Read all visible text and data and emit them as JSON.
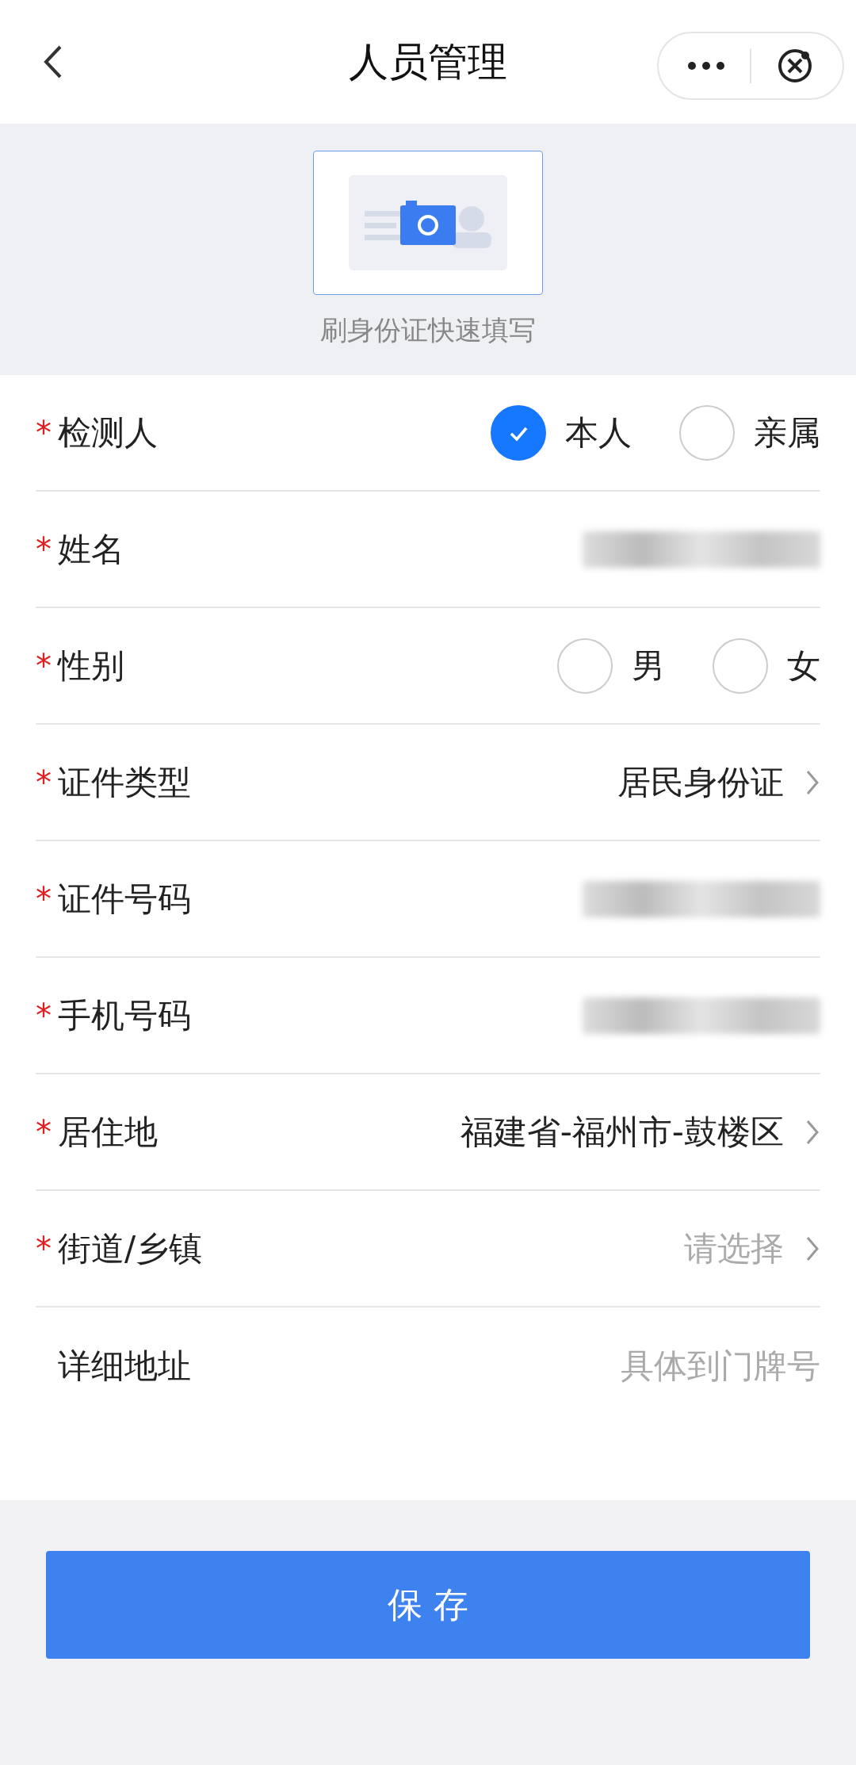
{
  "header": {
    "title": "人员管理"
  },
  "scan": {
    "caption": "刷身份证快速填写"
  },
  "rows": [
    {
      "kind": "radio",
      "mark": "*",
      "label": "检测人",
      "options": [
        {
          "label": "本人",
          "selected": true
        },
        {
          "label": "亲属",
          "selected": false
        }
      ]
    },
    {
      "kind": "redacted",
      "mark": "*",
      "label": "姓名"
    },
    {
      "kind": "radio",
      "mark": "*",
      "label": "性别",
      "options": [
        {
          "label": "男",
          "selected": false
        },
        {
          "label": "女",
          "selected": false
        }
      ]
    },
    {
      "kind": "select",
      "mark": "*",
      "label": "证件类型",
      "value": "居民身份证"
    },
    {
      "kind": "redacted",
      "mark": "*",
      "label": "证件号码"
    },
    {
      "kind": "redacted",
      "mark": "*",
      "label": "手机号码"
    },
    {
      "kind": "select",
      "mark": "*",
      "label": "居住地",
      "value": "福建省-福州市-鼓楼区"
    },
    {
      "kind": "select",
      "mark": "*",
      "label": "街道/乡镇",
      "placeholder": "请选择"
    },
    {
      "kind": "input",
      "label": "详细地址",
      "placeholder": "具体到门牌号"
    }
  ],
  "save_button": "保 存"
}
